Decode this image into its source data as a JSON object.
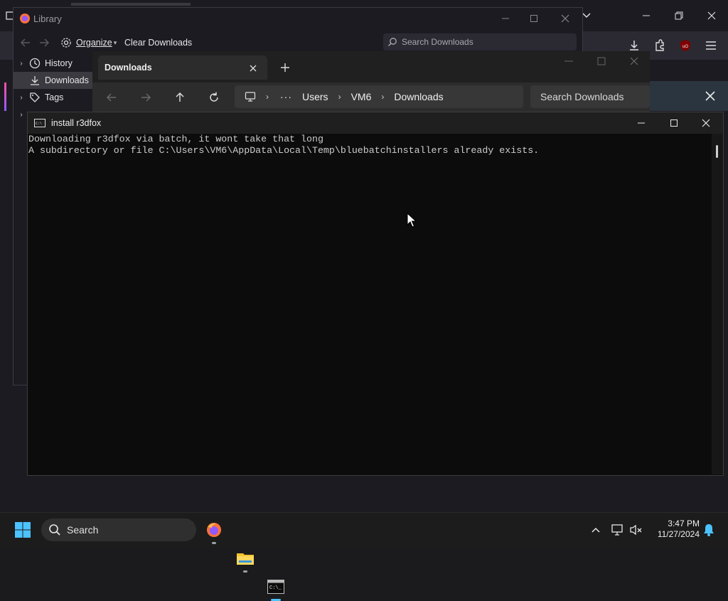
{
  "library_window": {
    "title": "Library",
    "organize_label": "Organize",
    "clear_downloads_label": "Clear Downloads",
    "search_placeholder": "Search Downloads",
    "sidebar": [
      {
        "label": "History",
        "icon": "history-icon",
        "selected": false
      },
      {
        "label": "Downloads",
        "icon": "download-icon",
        "selected": true
      },
      {
        "label": "Tags",
        "icon": "tag-icon",
        "selected": false
      }
    ]
  },
  "explorer_window": {
    "tab_title": "Downloads",
    "breadcrumbs": [
      "Users",
      "VM6",
      "Downloads"
    ],
    "search_placeholder": "Search Downloads"
  },
  "console_window": {
    "title": "install r3dfox",
    "lines": [
      "Downloading r3dfox via batch, it wont take that long",
      "A subdirectory or file C:\\Users\\VM6\\AppData\\Local\\Temp\\bluebatchinstallers already exists."
    ]
  },
  "taskbar": {
    "search_label": "Search",
    "time": "3:47 PM",
    "date": "11/27/2024",
    "apps": [
      "firefox",
      "file-explorer",
      "terminal"
    ]
  },
  "colors": {
    "accent": "#4cc2ff",
    "console_bg": "#0c0c0c",
    "console_text": "#cccccc",
    "ublock": "#800000"
  }
}
